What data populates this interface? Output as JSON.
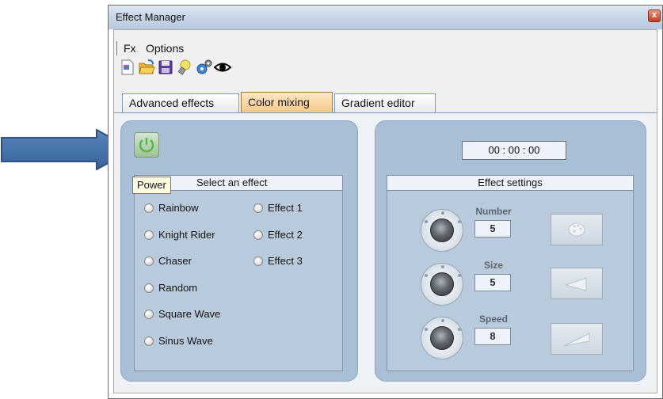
{
  "window": {
    "title": "Effect Manager",
    "close_glyph": "x"
  },
  "menu": {
    "items": [
      "Fx",
      "Options"
    ]
  },
  "toolbar": {
    "icons": [
      "new-effect-icon",
      "open-folder-icon",
      "save-icon",
      "lightbulb-icon",
      "settings-gears-icon",
      "preview-eye-icon"
    ]
  },
  "tabs": [
    {
      "label": "Advanced effects",
      "active": false
    },
    {
      "label": "Color mixing",
      "active": true
    },
    {
      "label": "Gradient editor",
      "active": false
    }
  ],
  "left_panel": {
    "power_tooltip": "Power",
    "header": "Select an effect",
    "effects_col1": [
      "Rainbow",
      "Knight Rider",
      "Chaser",
      "Random",
      "Square Wave",
      "Sinus Wave"
    ],
    "effects_col2": [
      "Effect 1",
      "Effect 2",
      "Effect 3"
    ]
  },
  "right_panel": {
    "timer": "00 : 00 : 00",
    "header": "Effect settings",
    "settings": [
      {
        "label": "Number",
        "value": "5"
      },
      {
        "label": "Size",
        "value": "5"
      },
      {
        "label": "Speed",
        "value": "8"
      }
    ]
  },
  "colors": {
    "panel": "#a9bfd6",
    "active_tab": "#f6c98b",
    "arrow": "#3f6ea8",
    "power_icon": "#4fbf3f"
  }
}
